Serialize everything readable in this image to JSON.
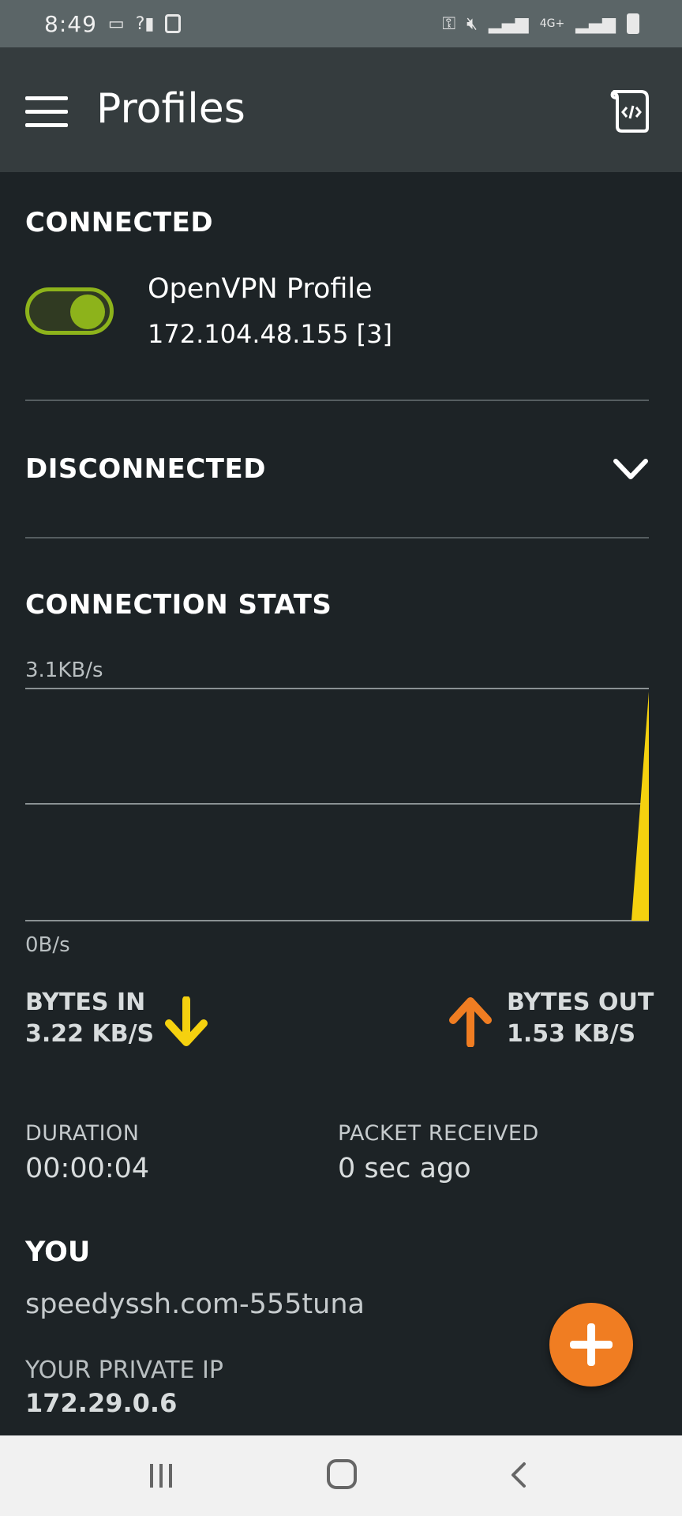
{
  "status_bar": {
    "time": "8:49",
    "left_icons": [
      "vpn-key-icon-small",
      "signal-icon",
      "screen-record-icon"
    ],
    "network": "4G+"
  },
  "app_bar": {
    "title": "Profiles"
  },
  "connected": {
    "title": "CONNECTED",
    "profile_name": "OpenVPN Profile",
    "profile_ip": "172.104.48.155 [3]",
    "toggle_on": true,
    "toggle_color": "#8db31b"
  },
  "disconnected": {
    "title": "DISCONNECTED"
  },
  "stats": {
    "title": "CONNECTION STATS",
    "max_label": "3.1KB/s",
    "min_label": "0B/s",
    "bytes_in_label": "BYTES IN",
    "bytes_in_value": "3.22 KB/S",
    "bytes_out_label": "BYTES OUT",
    "bytes_out_value": "1.53 KB/S",
    "in_color": "#f5d10f",
    "out_color": "#f07d22",
    "duration_label": "DURATION",
    "duration_value": "00:00:04",
    "packet_label": "PACKET RECEIVED",
    "packet_value": "0 sec ago"
  },
  "chart_data": {
    "type": "area",
    "ylim": [
      0,
      3.1
    ],
    "y_unit": "KB/s",
    "grid": true,
    "series": [
      {
        "values": [
          0,
          0,
          0,
          0,
          0,
          0,
          0,
          0,
          0,
          0,
          0,
          0,
          0,
          0,
          0,
          0,
          0,
          0,
          0,
          3.1
        ],
        "color": "#f5d10f"
      }
    ]
  },
  "you": {
    "title": "YOU",
    "username": "speedyssh.com-555tuna",
    "private_ip_label": "YOUR PRIVATE IP",
    "private_ip": "172.29.0.6"
  },
  "colors": {
    "background": "#1d2326",
    "app_bar": "#353c3e",
    "fab": "#f07d22"
  }
}
